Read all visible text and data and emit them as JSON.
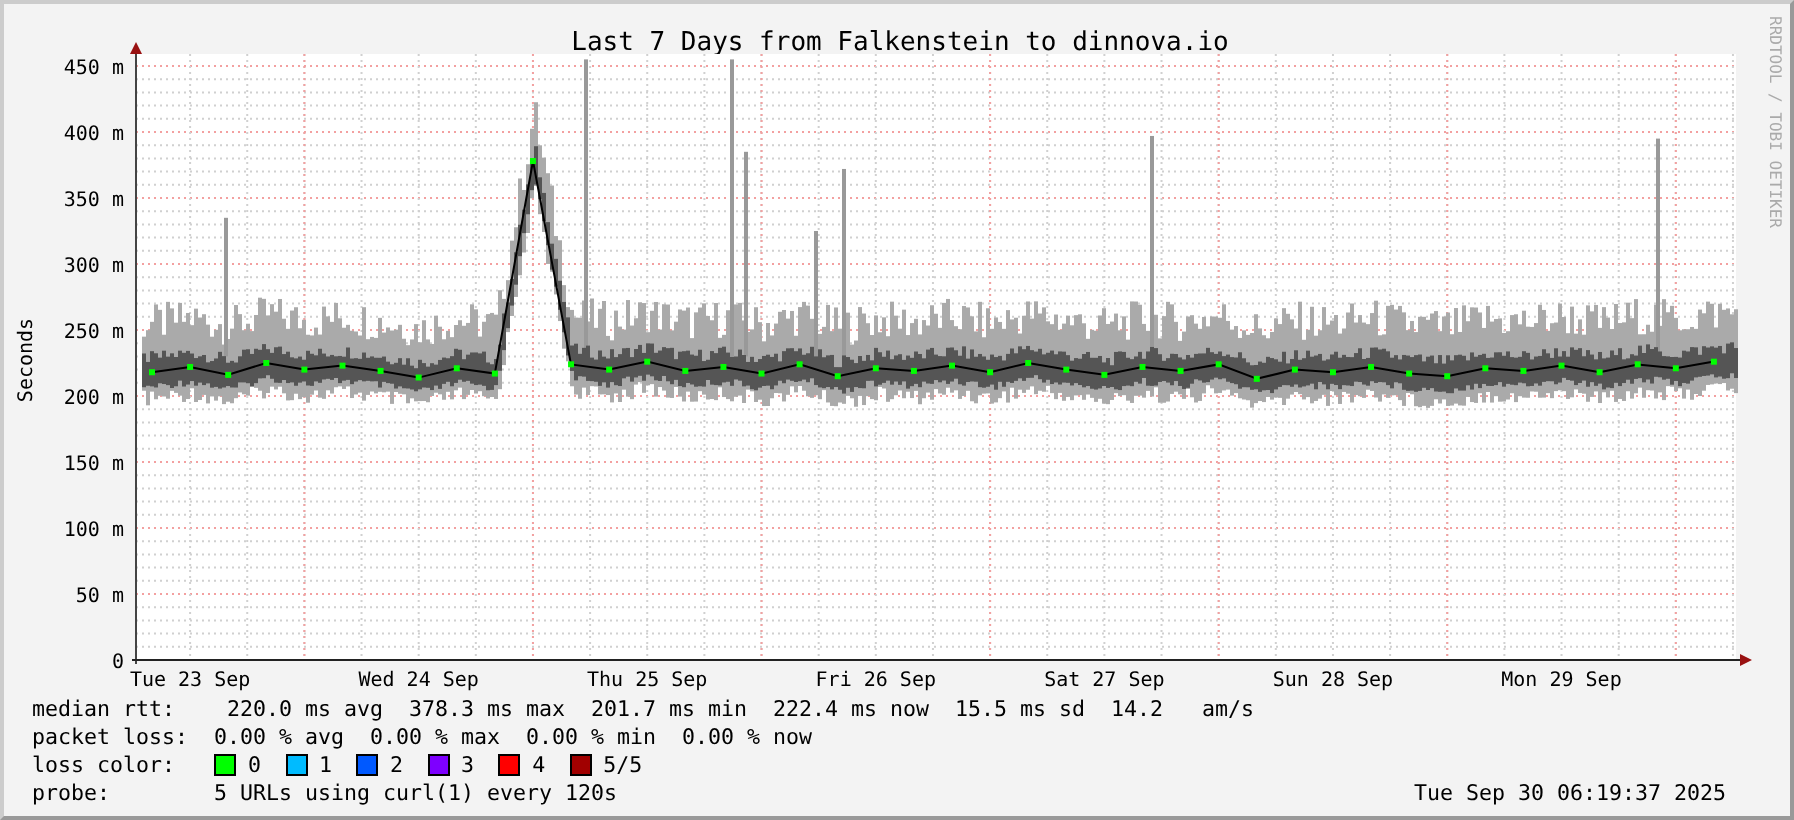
{
  "title": "Last 7 Days from Falkenstein to dinnova.io",
  "side_label": "RRDTOOL / TOBI OETIKER",
  "chart_data": {
    "type": "line",
    "ylabel": "Seconds",
    "ylim": [
      0,
      450
    ],
    "grid": true,
    "categories": [
      null,
      "Tue 23 Sep",
      null,
      null,
      null,
      null,
      null,
      "Wed 24 Sep",
      null,
      null,
      null,
      null,
      null,
      "Thu 25 Sep",
      null,
      null,
      null,
      null,
      null,
      "Fri 26 Sep",
      null,
      null,
      null,
      null,
      null,
      "Sat 27 Sep",
      null,
      null,
      null,
      null,
      null,
      "Sun 28 Sep",
      null,
      null,
      null,
      null,
      null,
      "Mon 29 Sep",
      null,
      null,
      null,
      null
    ],
    "series": [
      {
        "color": "#000000",
        "marker": "square",
        "values": [
          218,
          222,
          216,
          225,
          220,
          223,
          219,
          214,
          221,
          217,
          378,
          224,
          220,
          226,
          219,
          222,
          217,
          224,
          215,
          221,
          219,
          223,
          218,
          225,
          220,
          216,
          222,
          219,
          224,
          213,
          220,
          218,
          222,
          217,
          215,
          221,
          219,
          223,
          218,
          224,
          221,
          226
        ]
      }
    ],
    "yticks": [
      {
        "value": 0,
        "label": "0"
      },
      {
        "value": 50,
        "label": "50 m"
      },
      {
        "value": 100,
        "label": "100 m"
      },
      {
        "value": 150,
        "label": "150 m"
      },
      {
        "value": 200,
        "label": "200 m"
      },
      {
        "value": 250,
        "label": "250 m"
      },
      {
        "value": 300,
        "label": "300 m"
      },
      {
        "value": 350,
        "label": "350 m"
      },
      {
        "value": 400,
        "label": "400 m"
      },
      {
        "value": 450,
        "label": "450 m"
      }
    ]
  },
  "legend": [
    {
      "kind": "text",
      "label": "median rtt:",
      "text": " 220.0 ms avg  378.3 ms max  201.7 ms min  222.4 ms now  15.5 ms sd  14.2   am/s"
    },
    {
      "kind": "text",
      "label": "packet loss:",
      "text": "0.00 % avg  0.00 % max  0.00 % min  0.00 % now"
    },
    {
      "kind": "swatches",
      "label": "loss color:",
      "items": [
        {
          "label": "0",
          "color": "#00ff00"
        },
        {
          "label": "1",
          "color": "#00bbff"
        },
        {
          "label": "2",
          "color": "#0059ff"
        },
        {
          "label": "3",
          "color": "#7e00ff"
        },
        {
          "label": "4",
          "color": "#ff0000"
        },
        {
          "label": "5/5",
          "color": "#a10000"
        }
      ]
    },
    {
      "kind": "text",
      "label": "probe:",
      "text": "5 URLs using curl(1) every 120s"
    }
  ],
  "timestamp": "Tue Sep 30 06:19:37 2025"
}
